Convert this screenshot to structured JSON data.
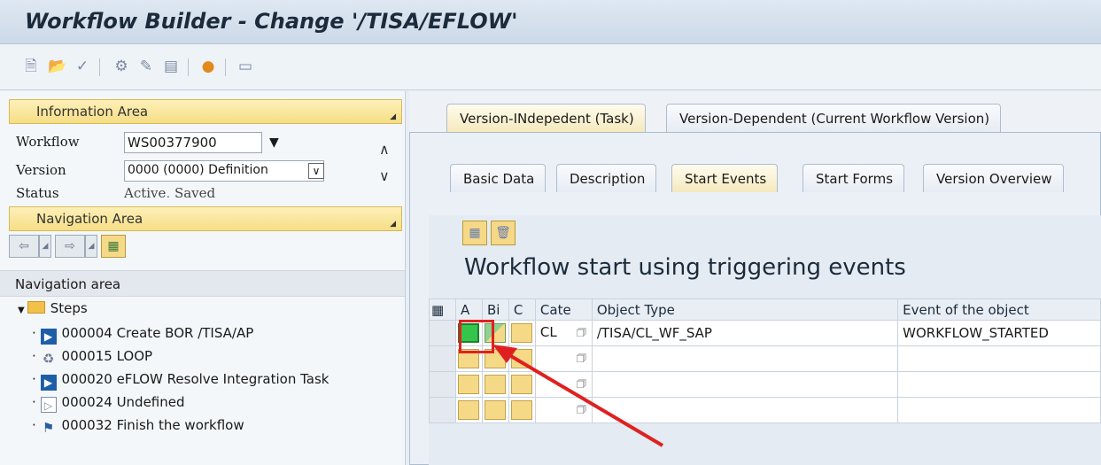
{
  "window": {
    "title": "Workflow Builder - Change '/TISA/EFLOW'"
  },
  "toolbar": {
    "icons": [
      "new-icon",
      "open-icon",
      "check-icon",
      "activate-icon",
      "edit-icon",
      "print-icon",
      "binding-icon",
      "layout-icon"
    ]
  },
  "info_area": {
    "header": "Information Area",
    "workflow_label": "Workflow",
    "workflow_value": "WS00377900",
    "version_label": "Version",
    "version_value": "0000 (0000) Definition",
    "status_label": "Status",
    "status_value": "Active, Saved"
  },
  "nav_area": {
    "header": "Navigation Area",
    "label": "Navigation area",
    "root": "Steps",
    "steps": [
      {
        "icon": "task-step-icon",
        "text": "000004 Create BOR /TISA/AP"
      },
      {
        "icon": "loop-step-icon",
        "text": "000015 LOOP"
      },
      {
        "icon": "task-step-icon",
        "text": "000020 eFLOW Resolve Integration Task"
      },
      {
        "icon": "undefined-step-icon",
        "text": "000024 Undefined"
      },
      {
        "icon": "end-step-icon",
        "text": "000032 Finish the workflow"
      }
    ]
  },
  "tabs_top": {
    "items": [
      "Version-INdepedent (Task)",
      "Version-Dependent (Current Workflow Version)"
    ],
    "active": 0
  },
  "tabs_sub": {
    "items": [
      "Basic Data",
      "Description",
      "Start Events",
      "Start Forms",
      "Version Overview"
    ],
    "active": 2
  },
  "start_events": {
    "title": "Workflow start using triggering events",
    "columns": [
      "A",
      "Bi",
      "C",
      "Cate",
      "Object Type",
      "Event of the object"
    ],
    "rows": [
      {
        "active": true,
        "binding": true,
        "category": "CL",
        "object_type": "/TISA/CL_WF_SAP",
        "event": "WORKFLOW_STARTED"
      },
      {
        "active": false,
        "binding": false,
        "category": "",
        "object_type": "",
        "event": ""
      },
      {
        "active": false,
        "binding": false,
        "category": "",
        "object_type": "",
        "event": ""
      },
      {
        "active": false,
        "binding": false,
        "category": "",
        "object_type": "",
        "event": ""
      }
    ]
  },
  "colors": {
    "annotation": "#e02020",
    "active_green": "#34c64a",
    "yellow": "#f6d987"
  }
}
